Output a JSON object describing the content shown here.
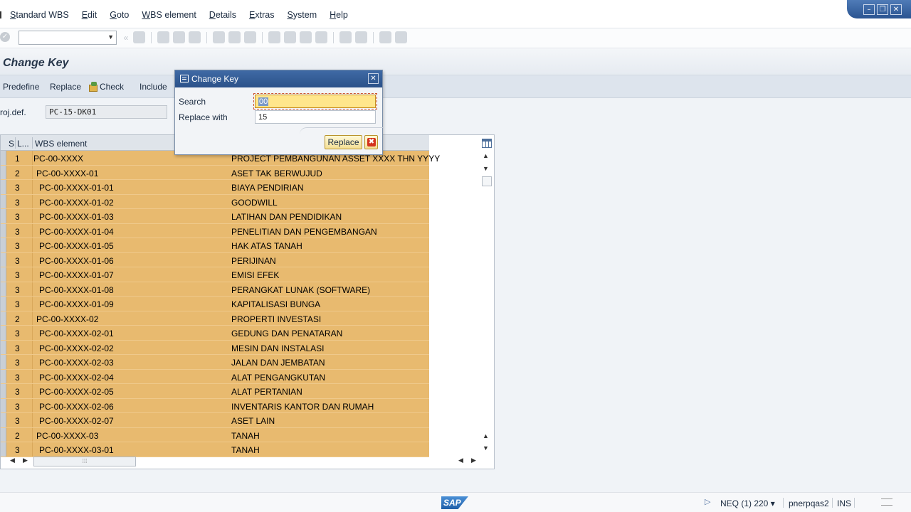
{
  "menu": {
    "items": [
      "Standard WBS",
      "Edit",
      "Goto",
      "WBS element",
      "Details",
      "Extras",
      "System",
      "Help"
    ],
    "mnemonic": [
      "S",
      "E",
      "G",
      "W",
      "D",
      "E",
      "S",
      "H"
    ]
  },
  "window_controls": {
    "minimize": "–",
    "restore": "❐",
    "close": "✕"
  },
  "toolbar": {
    "command_field_value": ""
  },
  "title": "Change Key",
  "app_toolbar": {
    "predefine": "Predefine",
    "replace": "Replace",
    "check": "Check",
    "include": "Include"
  },
  "project": {
    "label": "roj.def.",
    "value": "PC-15-DK01"
  },
  "table": {
    "headers": {
      "status": "S",
      "level": "L...",
      "wbs": "WBS element"
    },
    "rows": [
      {
        "level": "1",
        "wbs": "PC-00-XXXX",
        "desc": "PROJECT PEMBANGUNAN ASSET XXXX THN YYYY"
      },
      {
        "level": "2",
        "wbs": "PC-00-XXXX-01",
        "desc": "ASET TAK BERWUJUD"
      },
      {
        "level": "3",
        "wbs": "PC-00-XXXX-01-01",
        "desc": "BIAYA PENDIRIAN"
      },
      {
        "level": "3",
        "wbs": "PC-00-XXXX-01-02",
        "desc": "GOODWILL"
      },
      {
        "level": "3",
        "wbs": "PC-00-XXXX-01-03",
        "desc": "LATIHAN DAN PENDIDIKAN"
      },
      {
        "level": "3",
        "wbs": "PC-00-XXXX-01-04",
        "desc": "PENELITIAN DAN PENGEMBANGAN"
      },
      {
        "level": "3",
        "wbs": "PC-00-XXXX-01-05",
        "desc": "HAK ATAS TANAH"
      },
      {
        "level": "3",
        "wbs": "PC-00-XXXX-01-06",
        "desc": "PERIJINAN"
      },
      {
        "level": "3",
        "wbs": "PC-00-XXXX-01-07",
        "desc": "EMISI EFEK"
      },
      {
        "level": "3",
        "wbs": "PC-00-XXXX-01-08",
        "desc": "PERANGKAT LUNAK (SOFTWARE)"
      },
      {
        "level": "3",
        "wbs": "PC-00-XXXX-01-09",
        "desc": "KAPITALISASI BUNGA"
      },
      {
        "level": "2",
        "wbs": "PC-00-XXXX-02",
        "desc": "PROPERTI INVESTASI"
      },
      {
        "level": "3",
        "wbs": "PC-00-XXXX-02-01",
        "desc": "GEDUNG DAN PENATARAN"
      },
      {
        "level": "3",
        "wbs": "PC-00-XXXX-02-02",
        "desc": "MESIN DAN INSTALASI"
      },
      {
        "level": "3",
        "wbs": "PC-00-XXXX-02-03",
        "desc": "JALAN DAN JEMBATAN"
      },
      {
        "level": "3",
        "wbs": "PC-00-XXXX-02-04",
        "desc": "ALAT PENGANGKUTAN"
      },
      {
        "level": "3",
        "wbs": "PC-00-XXXX-02-05",
        "desc": "ALAT PERTANIAN"
      },
      {
        "level": "3",
        "wbs": "PC-00-XXXX-02-06",
        "desc": "INVENTARIS KANTOR DAN RUMAH"
      },
      {
        "level": "3",
        "wbs": "PC-00-XXXX-02-07",
        "desc": "ASET LAIN"
      },
      {
        "level": "2",
        "wbs": "PC-00-XXXX-03",
        "desc": "TANAH"
      },
      {
        "level": "3",
        "wbs": "PC-00-XXXX-03-01",
        "desc": "TANAH"
      }
    ],
    "row_color": "#e8ba6f"
  },
  "dialog": {
    "title": "Change Key",
    "search_label": "Search",
    "search_value": "00",
    "replace_label": "Replace with",
    "replace_value": "15",
    "replace_button": "Replace",
    "cancel_icon": "✖"
  },
  "statusbar": {
    "logo": "SAP",
    "system": "NEQ (1) 220",
    "host": "pnerpqas2",
    "mode": "INS"
  }
}
